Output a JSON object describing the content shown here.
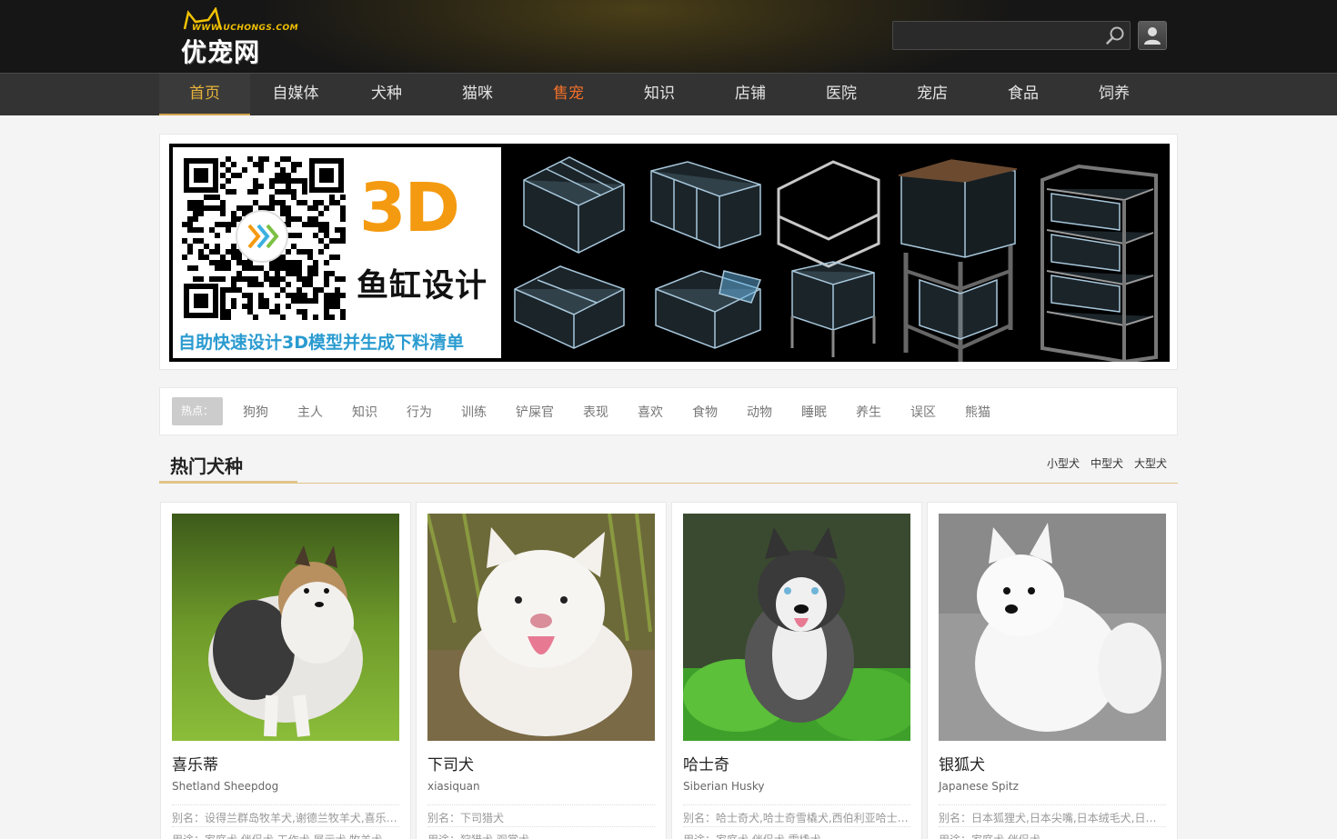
{
  "header": {
    "logo_url_text": "WWW.UCHONGS.COM",
    "logo_name": "优宠网",
    "search": {
      "value": "",
      "placeholder": ""
    },
    "search_icon": "magnifier-icon",
    "user_icon": "user-silhouette-icon"
  },
  "nav": {
    "items": [
      {
        "label": "首页"
      },
      {
        "label": "自媒体"
      },
      {
        "label": "犬种"
      },
      {
        "label": "猫咪"
      },
      {
        "label": "售宠"
      },
      {
        "label": "知识"
      },
      {
        "label": "店铺"
      },
      {
        "label": "医院"
      },
      {
        "label": "宠店"
      },
      {
        "label": "食品"
      },
      {
        "label": "饲养"
      }
    ],
    "active_color": "#e7b23a",
    "highlight_color": "#f3702a"
  },
  "banner": {
    "big_text": "3D",
    "title": "鱼缸设计",
    "subtitle": "自助快速设计3D模型并生成下料清单",
    "big_text_color": "#f49a10",
    "subtitle_color": "#2a9bd0"
  },
  "hot_tags": {
    "label": "热点：",
    "items": [
      "狗狗",
      "主人",
      "知识",
      "行为",
      "训练",
      "铲屎官",
      "表现",
      "喜欢",
      "食物",
      "动物",
      "睡眠",
      "养生",
      "误区",
      "熊猫"
    ]
  },
  "section": {
    "title": "热门犬种",
    "links": [
      "小型犬",
      "中型犬",
      "大型犬"
    ],
    "accent_color": "#e0c488"
  },
  "cards": [
    {
      "name": "喜乐蒂",
      "en": "Shetland Sheepdog",
      "alias": "别名：设得兰群岛牧羊犬,谢德兰牧羊犬,喜乐蒂牧羊犬",
      "use": "用途：家庭犬,伴侣犬,工作犬,展示犬,牧羊犬"
    },
    {
      "name": "下司犬",
      "en": "xiasiquan",
      "alias": "别名：下司猎犬",
      "use": "用途：狩猎犬,观赏犬"
    },
    {
      "name": "哈士奇",
      "en": "Siberian Husky",
      "alias": "别名：哈士奇犬,哈士奇雪橇犬,西伯利亚哈士奇犬",
      "use": "用途：家庭犬,伴侣犬,雪橇犬"
    },
    {
      "name": "银狐犬",
      "en": "Japanese Spitz",
      "alias": "别名：日本狐狸犬,日本尖嘴,日本绒毛犬,日本丝毛犬",
      "use": "用途：家庭犬,伴侣犬"
    }
  ]
}
